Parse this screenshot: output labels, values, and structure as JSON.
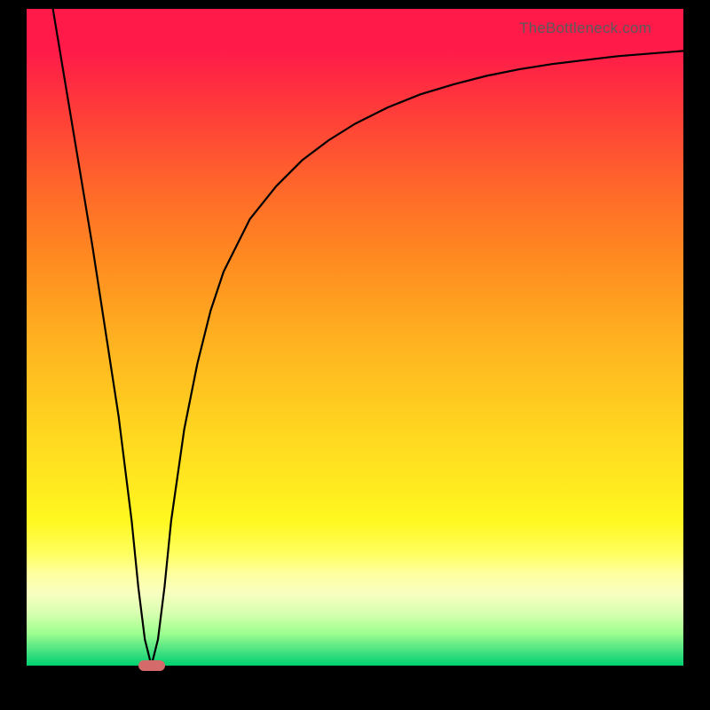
{
  "watermark": "TheBottleneck.com",
  "colors": {
    "top_red": "#ff1a4a",
    "mid_orange": "#ff8a20",
    "mid_yellow": "#ffe820",
    "bottom_green": "#00d070",
    "curve_stroke": "#000000",
    "marker_fill": "#d46a6a",
    "frame": "#000000",
    "watermark_color": "#5a5a5a"
  },
  "chart_data": {
    "type": "line",
    "title": "",
    "xlabel": "",
    "ylabel": "",
    "xlim": [
      0,
      100
    ],
    "ylim": [
      0,
      100
    ],
    "grid": false,
    "legend": false,
    "x": [
      4,
      6,
      8,
      10,
      12,
      14,
      16,
      17,
      18,
      19,
      20,
      21,
      22,
      24,
      26,
      28,
      30,
      34,
      38,
      42,
      46,
      50,
      55,
      60,
      65,
      70,
      75,
      80,
      85,
      90,
      95,
      100
    ],
    "y": [
      100,
      88,
      76,
      64,
      51,
      38,
      22,
      12,
      4,
      0,
      4,
      12,
      22,
      36,
      46,
      54,
      60,
      68,
      73,
      77,
      80,
      82.5,
      85,
      87,
      88.5,
      89.8,
      90.8,
      91.6,
      92.2,
      92.8,
      93.2,
      93.6
    ],
    "annotations": [
      {
        "type": "marker",
        "x": 19,
        "y": 0,
        "shape": "rounded-bar"
      }
    ]
  }
}
